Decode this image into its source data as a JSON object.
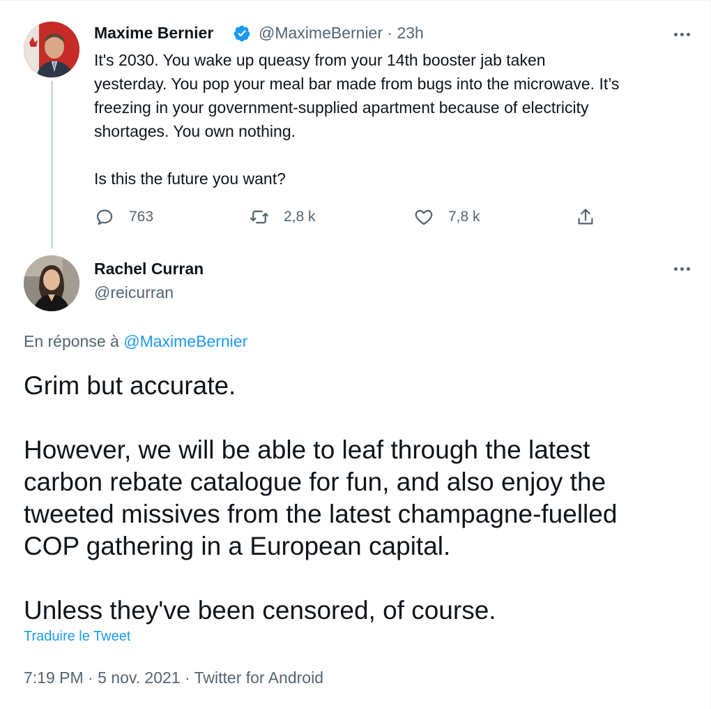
{
  "parent_tweet": {
    "author_name": "Maxime Bernier",
    "handle": "@MaximeBernier",
    "time": "23h",
    "handle_time": "@MaximeBernier · 23h",
    "verified": true,
    "text": "It's 2030. You wake up queasy from your 14th booster jab taken\nyesterday. You pop your meal bar made from bugs into the microwave. It’s\nfreezing in your government-supplied apartment because of electricity\nshortages. You own nothing.\n\nIs this the future you want?",
    "replies": "763",
    "retweets": "2,8 k",
    "likes": "7,8 k",
    "icons": [
      "comment-icon",
      "retweet-icon",
      "heart-icon",
      "share-icon",
      "more-icon",
      "verified-badge-icon"
    ]
  },
  "reply_tweet": {
    "author_name": "Rachel Curran",
    "handle": "@reicurran",
    "replying_prefix": "En réponse à",
    "replying_to": "@MaximeBernier",
    "text": "Grim but accurate.\n\nHowever, we will be able to leaf through the latest\ncarbon rebate catalogue for fun, and also enjoy the\ntweeted missives from the latest champagne-fuelled\nCOP gathering in a European capital.\n\nUnless they've been censored, of course.",
    "translate_label": "Traduire le Tweet",
    "meta": "7:19 PM · 5 nov. 2021 · Twitter for Android"
  },
  "colors": {
    "text_primary": "#0f1419",
    "text_secondary": "#536471",
    "link_blue": "#1d9bf0",
    "thread_line": "#cfd9de"
  }
}
